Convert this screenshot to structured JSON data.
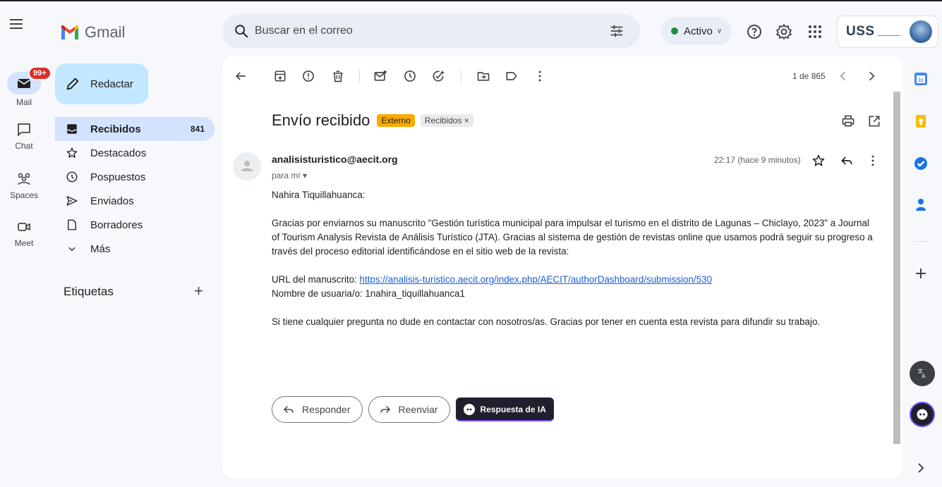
{
  "app": {
    "name": "Gmail"
  },
  "search": {
    "placeholder": "Buscar en el correo"
  },
  "status": {
    "label": "Activo"
  },
  "account": {
    "org_label": "USS"
  },
  "rail": {
    "mail": "Mail",
    "mail_badge": "99+",
    "chat": "Chat",
    "spaces": "Spaces",
    "meet": "Meet"
  },
  "compose": {
    "label": "Redactar"
  },
  "nav": {
    "items": [
      {
        "label": "Recibidos",
        "count": "841",
        "icon": "inbox-icon"
      },
      {
        "label": "Destacados",
        "icon": "star-icon"
      },
      {
        "label": "Pospuestos",
        "icon": "clock-icon"
      },
      {
        "label": "Enviados",
        "icon": "send-icon"
      },
      {
        "label": "Borradores",
        "icon": "draft-icon"
      },
      {
        "label": "Más",
        "icon": "chevron-down-icon"
      }
    ]
  },
  "labels": {
    "title": "Etiquetas"
  },
  "toolbar": {
    "pager": "1 de 865"
  },
  "email": {
    "subject": "Envío recibido",
    "tag_external": "Externo",
    "tag_inbox": "Recibidos ×",
    "sender": "analisisturistico@aecit.org",
    "to": "para mí",
    "time": "22:17 (hace 9 minutos)",
    "greeting": "Nahira Tiquillahuanca:",
    "paragraph1": "Gracias por enviarnos su manuscrito \"Gestión turística municipal para impulsar el turismo en el distrito de Lagunas – Chiclayo, 2023\" a Journal of Tourism Analysis Revista de Análisis Turístico (JTA). Gracias al sistema de gestión de revistas online que usamos podrá seguir su progreso a través del proceso editorial identificándose en el sitio web de la revista:",
    "url_label": "URL del manuscrito: ",
    "url": "https://analisis-turistico.aecit.org/index.php/AECIT/authorDashboard/submission/530",
    "user_line": "Nombre de usuaria/o: 1nahira_tiquillahuanca1",
    "closing": "Si tiene cualquier pregunta no dude en contactar con nosotros/as. Gracias por tener en cuenta esta revista para difundir su trabajo."
  },
  "actions": {
    "reply": "Responder",
    "forward": "Reenviar",
    "ai_reply": "Respuesta de IA"
  },
  "colors": {
    "accent": "#c2e7ff",
    "active_nav": "#d3e3fd",
    "external_tag": "#f9ab00",
    "link": "#1a5fd8",
    "status_green": "#1e8e3e",
    "badge_red": "#d93025"
  }
}
